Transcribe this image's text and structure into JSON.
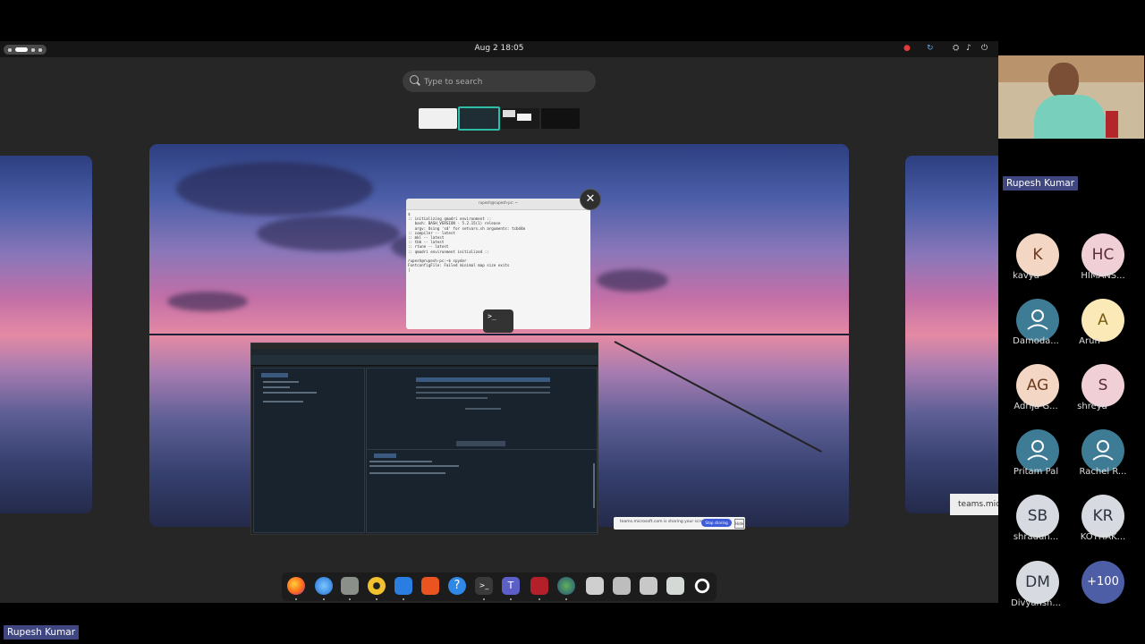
{
  "topbar": {
    "clock": "Aug 2  18:05"
  },
  "search": {
    "placeholder": "Type to search"
  },
  "terminal": {
    "title": "rupesh@rupesh-pc: ~",
    "lines": [
      "$",
      ":: initializing qmadri environment ::",
      "   bash: BASH_VERSION - 5.2.15(1) release",
      "   argv: Using 'sd' for setvars.sh arguments: tcbd4m",
      ":: compiler -- latest",
      ":: mkl -- latest",
      ":: tbb -- latest",
      ":: rtune -- latest",
      ":: qmadri environment initialized ::",
      "",
      "rupesh@rupesh-pc:~$ spyder",
      "FontconfigFile: Failed minimal map size exits",
      "|"
    ]
  },
  "teams_share": {
    "text": "teams.microsoft.com is sharing your screen.",
    "stop_label": "Stop sharing",
    "hide_label": "Hide"
  },
  "teams_tooltip": "teams.micro",
  "presenter": {
    "name": "Rupesh Kumar"
  },
  "participants": [
    {
      "initials": "K",
      "name": "kavya"
    },
    {
      "initials": "HC",
      "name": "HIMANS..."
    },
    {
      "initials": "",
      "name": "Damoda..."
    },
    {
      "initials": "A",
      "name": "Arun"
    },
    {
      "initials": "AG",
      "name": "Adrija G..."
    },
    {
      "initials": "S",
      "name": "shreya"
    },
    {
      "initials": "",
      "name": "Pritam Pal"
    },
    {
      "initials": "",
      "name": "Rachel R..."
    },
    {
      "initials": "SB",
      "name": "shraddh..."
    },
    {
      "initials": "KR",
      "name": "KOTHAK..."
    },
    {
      "initials": "DM",
      "name": "Divyansh..."
    }
  ],
  "more_participants": "+100",
  "colors": {
    "accent": "#2dbfa6",
    "peach_avatar": "#f3d7c4",
    "pink_avatar": "#f0d0d6",
    "teal_avatar": "#3e7b94",
    "gray_avatar": "#d7dbe1",
    "nametag": "#3f4680"
  },
  "dock_apps": [
    "firefox-icon",
    "thunderbird-icon",
    "files-icon",
    "rhythmbox-icon",
    "writer-icon",
    "software-icon",
    "help-icon",
    "terminal-icon",
    "teams-icon",
    "pdf-reader-icon",
    "globe-icon",
    "document-icon",
    "disk-icon",
    "removable-drive-icon",
    "trash-icon",
    "show-apps-icon"
  ]
}
